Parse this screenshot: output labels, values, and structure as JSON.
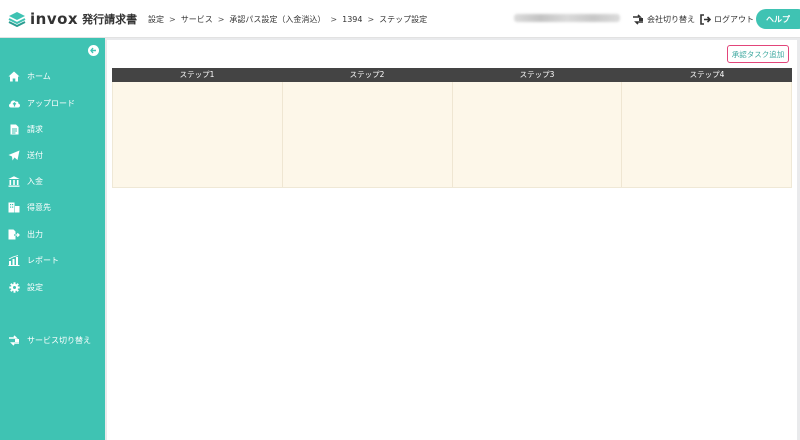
{
  "header": {
    "logo_en": "invox",
    "logo_jp": "発行請求書",
    "breadcrumb": [
      "設定",
      "サービス",
      "承認パス設定（入金消込）",
      "1394",
      "ステップ設定"
    ],
    "company_switch_label": "会社切り替え",
    "logout_label": "ログアウト",
    "help_label": "ヘルプ"
  },
  "sidebar": {
    "items": [
      {
        "label": "ホーム",
        "icon": "home-icon"
      },
      {
        "label": "アップロード",
        "icon": "cloud-upload-icon"
      },
      {
        "label": "請求",
        "icon": "document-icon"
      },
      {
        "label": "送付",
        "icon": "paper-plane-icon"
      },
      {
        "label": "入金",
        "icon": "bank-icon"
      },
      {
        "label": "得意先",
        "icon": "building-icon"
      },
      {
        "label": "出力",
        "icon": "file-export-icon"
      },
      {
        "label": "レポート",
        "icon": "chart-icon"
      },
      {
        "label": "設定",
        "icon": "gear-icon"
      }
    ],
    "service_switch_label": "サービス切り替え"
  },
  "main": {
    "add_task_label": "承認タスク追加",
    "steps": [
      "ステップ1",
      "ステップ2",
      "ステップ3",
      "ステップ4"
    ]
  },
  "colors": {
    "accent": "#3fc3b3",
    "highlight_border": "#e2457a",
    "step_header_bg": "#444444",
    "step_body_bg": "#fdf7e9"
  }
}
